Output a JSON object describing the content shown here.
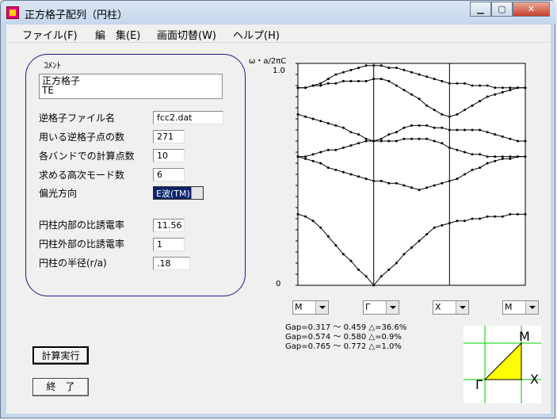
{
  "window": {
    "title": "正方格子配列（円柱）"
  },
  "menu": [
    {
      "label": "ファイル(F)",
      "underline_index": 5
    },
    {
      "label": "編　集(E)",
      "underline_index": 4
    },
    {
      "label": "画面切替(W)",
      "underline_index": 5
    },
    {
      "label": "ヘルプ(H)",
      "underline_index": 4
    }
  ],
  "comment": {
    "label": "ｺﾒﾝﾄ",
    "line1": "正方格子",
    "line2": "TE"
  },
  "params": {
    "file_label": "逆格子ファイル名",
    "file_value": "fcc2.dat",
    "points_label": "用いる逆格子点の数",
    "points_value": "271",
    "calc_label": "各バンドでの計算点数",
    "calc_value": "10",
    "modes_label": "求める高次モード数",
    "modes_value": "6",
    "pol_label": "偏光方向",
    "pol_value": "E波(TM)",
    "eps_in_label": "円柱内部の比誘電率",
    "eps_in_value": "11.56",
    "eps_out_label": "円柱外部の比誘電率",
    "eps_out_value": "1",
    "radius_label": "円柱の半径(r/a)",
    "radius_value": ".18"
  },
  "buttons": {
    "run": "計算実行",
    "exit": "終　了"
  },
  "path_selectors": [
    "M",
    "Γ",
    "X",
    "M"
  ],
  "gaps": [
    "Gap=0.317 ～ 0.459 △=36.6%",
    "Gap=0.574 ～ 0.580 △=0.9%",
    "Gap=0.765 ～ 0.772 △=1.0%"
  ],
  "brillouin": {
    "corner_m": "M",
    "corner_g": "Γ",
    "corner_x": "X",
    "fill_color": "#ffff00"
  },
  "chart_data": {
    "type": "line",
    "ylabel": "ω・a/2πC",
    "ylim": [
      0,
      1.0
    ],
    "ytick_labels": [
      "0",
      "1.0"
    ],
    "segments": [
      "M-Γ",
      "Γ-X",
      "X-M"
    ],
    "x": [
      0.0,
      0.1,
      0.2,
      0.3,
      0.4,
      0.5,
      0.6,
      0.7,
      0.8,
      0.9,
      1.0,
      1.1,
      1.2,
      1.3,
      1.4,
      1.5,
      1.6,
      1.7,
      1.8,
      1.9,
      2.0,
      2.1,
      2.2,
      2.3,
      2.4,
      2.5,
      2.6,
      2.7,
      2.8,
      2.9,
      3.0
    ],
    "series": [
      {
        "values": [
          0.32,
          0.31,
          0.29,
          0.26,
          0.22,
          0.18,
          0.14,
          0.11,
          0.07,
          0.04,
          0.0,
          0.04,
          0.07,
          0.1,
          0.14,
          0.17,
          0.2,
          0.23,
          0.26,
          0.27,
          0.28,
          0.29,
          0.29,
          0.3,
          0.3,
          0.31,
          0.31,
          0.31,
          0.32,
          0.32,
          0.32
        ]
      },
      {
        "values": [
          0.58,
          0.57,
          0.56,
          0.55,
          0.53,
          0.52,
          0.51,
          0.5,
          0.49,
          0.48,
          0.47,
          0.47,
          0.46,
          0.46,
          0.45,
          0.44,
          0.43,
          0.44,
          0.45,
          0.46,
          0.47,
          0.48,
          0.5,
          0.52,
          0.53,
          0.55,
          0.56,
          0.57,
          0.57,
          0.58,
          0.58
        ]
      },
      {
        "values": [
          0.58,
          0.58,
          0.59,
          0.6,
          0.61,
          0.61,
          0.62,
          0.63,
          0.64,
          0.65,
          0.65,
          0.65,
          0.65,
          0.65,
          0.66,
          0.66,
          0.66,
          0.66,
          0.65,
          0.64,
          0.62,
          0.61,
          0.6,
          0.59,
          0.59,
          0.58,
          0.58,
          0.58,
          0.58,
          0.58,
          0.58
        ]
      },
      {
        "values": [
          0.77,
          0.76,
          0.75,
          0.74,
          0.73,
          0.72,
          0.71,
          0.69,
          0.68,
          0.66,
          0.65,
          0.66,
          0.68,
          0.69,
          0.71,
          0.72,
          0.72,
          0.72,
          0.71,
          0.71,
          0.7,
          0.7,
          0.7,
          0.7,
          0.7,
          0.69,
          0.68,
          0.67,
          0.66,
          0.65,
          0.65
        ]
      },
      {
        "values": [
          0.89,
          0.89,
          0.9,
          0.9,
          0.91,
          0.91,
          0.92,
          0.92,
          0.92,
          0.92,
          0.93,
          0.93,
          0.92,
          0.9,
          0.88,
          0.86,
          0.84,
          0.81,
          0.79,
          0.77,
          0.76,
          0.77,
          0.79,
          0.81,
          0.83,
          0.85,
          0.86,
          0.87,
          0.88,
          0.89,
          0.89
        ]
      },
      {
        "values": [
          0.89,
          0.89,
          0.9,
          0.91,
          0.93,
          0.95,
          0.96,
          0.97,
          0.98,
          0.99,
          0.99,
          0.99,
          0.98,
          0.98,
          0.97,
          0.96,
          0.95,
          0.94,
          0.93,
          0.92,
          0.91,
          0.91,
          0.91,
          0.9,
          0.9,
          0.9,
          0.89,
          0.89,
          0.89,
          0.89,
          0.89
        ]
      }
    ]
  }
}
